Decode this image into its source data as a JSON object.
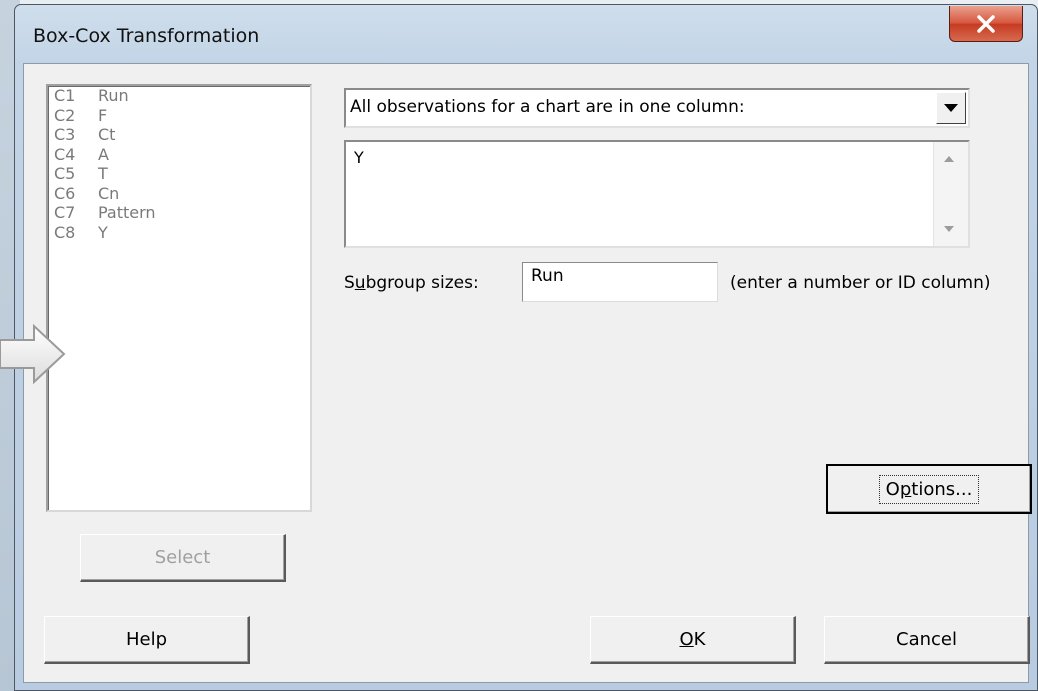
{
  "dialog": {
    "title": "Box-Cox Transformation"
  },
  "variables": [
    {
      "id": "C1",
      "name": "Run"
    },
    {
      "id": "C2",
      "name": "F"
    },
    {
      "id": "C3",
      "name": "Ct"
    },
    {
      "id": "C4",
      "name": "A"
    },
    {
      "id": "C5",
      "name": "T"
    },
    {
      "id": "C6",
      "name": "Cn"
    },
    {
      "id": "C7",
      "name": "Pattern"
    },
    {
      "id": "C8",
      "name": "Y"
    }
  ],
  "layout_select": {
    "value": "All observations for a chart are in one column:"
  },
  "columns_box": {
    "value": "Y"
  },
  "subgroup": {
    "label_pre": "S",
    "label_mnemonic": "u",
    "label_post": "bgroup sizes:",
    "value": "Run",
    "hint": "(enter a number or ID column)"
  },
  "buttons": {
    "select": "Select",
    "options_pre": "O",
    "options_mnemonic": "p",
    "options_post": "tions...",
    "help": "Help",
    "ok_mnemonic": "O",
    "ok_post": "K",
    "cancel": "Cancel"
  }
}
